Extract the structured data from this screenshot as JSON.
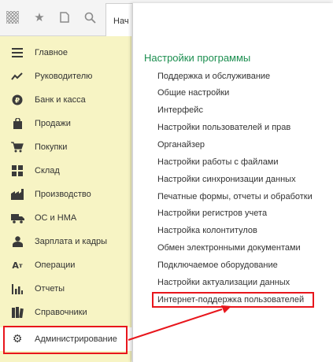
{
  "toolbar": {
    "tab_label": "Нач",
    "icons": [
      "apps-grid-icon",
      "star-icon",
      "history-icon",
      "search-icon"
    ]
  },
  "sidebar": {
    "items": [
      {
        "icon": "menu-lines-icon",
        "label": "Главное"
      },
      {
        "icon": "trend-chart-icon",
        "label": "Руководителю"
      },
      {
        "icon": "coin-icon",
        "label": "Банк и касса"
      },
      {
        "icon": "shopping-bag-icon",
        "label": "Продажи"
      },
      {
        "icon": "cart-icon",
        "label": "Покупки"
      },
      {
        "icon": "warehouse-blocks-icon",
        "label": "Склад"
      },
      {
        "icon": "factory-icon",
        "label": "Производство"
      },
      {
        "icon": "truck-icon",
        "label": "ОС и НМА"
      },
      {
        "icon": "person-icon",
        "label": "Зарплата и кадры"
      },
      {
        "icon": "operations-icon",
        "label": "Операции"
      },
      {
        "icon": "bar-chart-icon",
        "label": "Отчеты"
      },
      {
        "icon": "books-icon",
        "label": "Справочники"
      },
      {
        "icon": "gear-icon",
        "label": "Администрирование"
      }
    ]
  },
  "panel": {
    "title": "Настройки программы",
    "links": [
      "Поддержка и обслуживание",
      "Общие настройки",
      "Интерфейс",
      "Настройки пользователей и прав",
      "Органайзер",
      "Настройки работы с файлами",
      "Настройки синхронизации данных",
      "Печатные формы, отчеты и обработки",
      "Настройки регистров учета",
      "Настройка колонтитулов",
      "Обмен электронными документами",
      "Подключаемое оборудование",
      "Настройки актуализации данных",
      "Интернет-поддержка пользователей"
    ]
  },
  "colors": {
    "sidebar_bg": "#f7f4c4",
    "title_green": "#1b8e4f",
    "highlight_red": "#e8161c"
  }
}
